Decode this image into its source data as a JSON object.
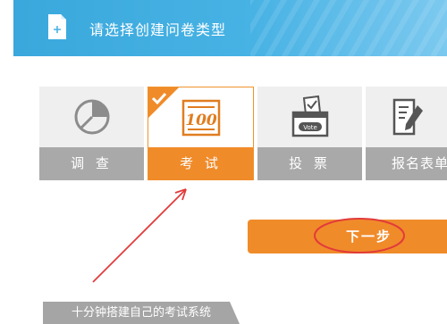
{
  "header": {
    "title": "请选择创建问卷类型",
    "icon": "document-add-icon"
  },
  "types": [
    {
      "label": "调 查",
      "icon": "pie-chart-icon",
      "selected": false
    },
    {
      "label": "考 试",
      "icon": "exam-100-icon",
      "selected": true
    },
    {
      "label": "投 票",
      "icon": "ballot-box-icon",
      "selected": false
    },
    {
      "label": "报名表单",
      "icon": "form-pen-icon",
      "selected": false
    }
  ],
  "next_button": {
    "label": "下一步"
  },
  "caption": "十分钟搭建自己的考试系统",
  "colors": {
    "header_blue": "#47b2e4",
    "accent_orange": "#f08b2a",
    "card_gray": "#a9a9a9",
    "annotation_red": "#e23b3b"
  }
}
